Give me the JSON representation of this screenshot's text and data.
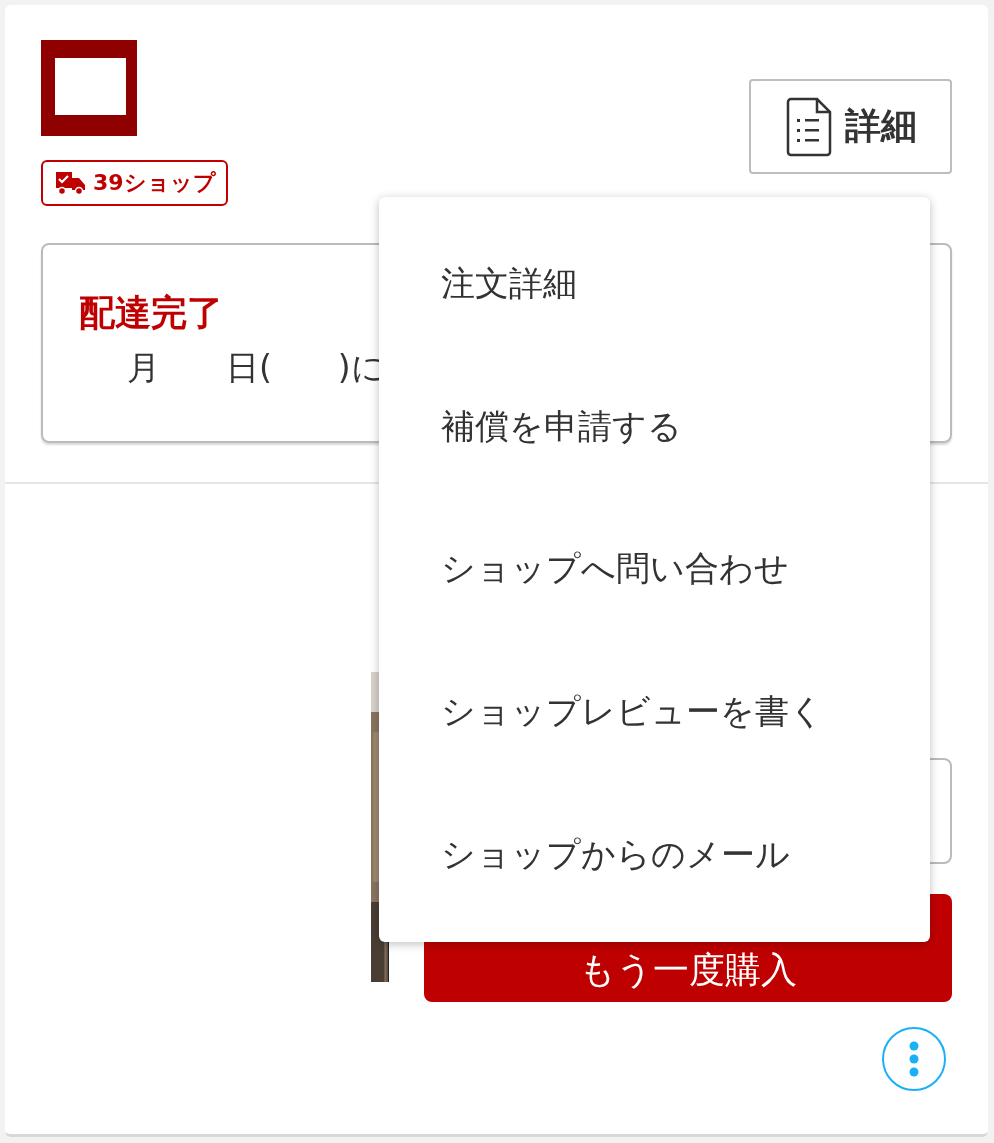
{
  "shop": {
    "badge": "39ショップ"
  },
  "details_button": {
    "label": "詳細"
  },
  "status": {
    "title": "配達完了",
    "message": "月　　日(　　)に"
  },
  "buy_again_button": {
    "label": "もう一度購入"
  },
  "menu": {
    "items": [
      {
        "label": "注文詳細"
      },
      {
        "label": "補償を申請する"
      },
      {
        "label": "ショップへ問い合わせ"
      },
      {
        "label": "ショップレビューを書く"
      },
      {
        "label": "ショップからのメール"
      }
    ]
  }
}
